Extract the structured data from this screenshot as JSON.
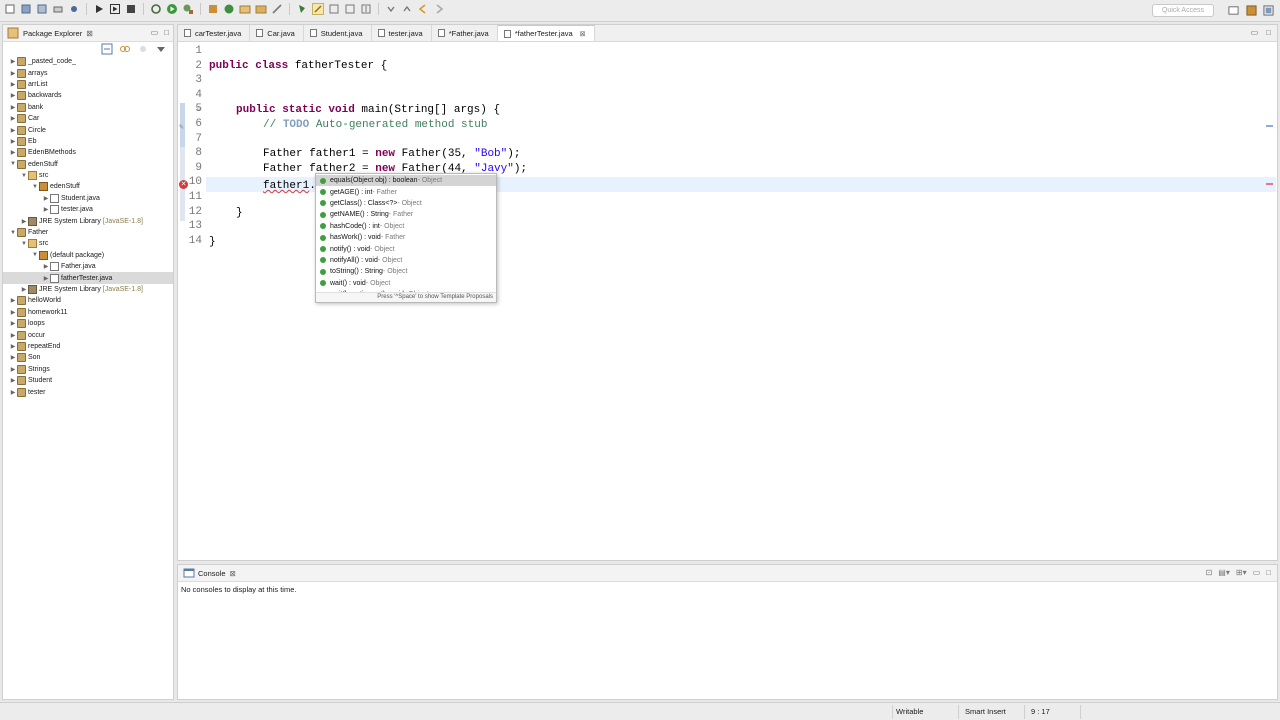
{
  "toolbar": {
    "quick_access_placeholder": "Quick Access"
  },
  "package_explorer": {
    "title": "Package Explorer",
    "items": [
      {
        "label": "_pasted_code_",
        "depth": 0,
        "toggle": "▶",
        "icon": "project-icon"
      },
      {
        "label": "arrays",
        "depth": 0,
        "toggle": "▶",
        "icon": "project-icon"
      },
      {
        "label": "arrList",
        "depth": 0,
        "toggle": "▶",
        "icon": "project-icon"
      },
      {
        "label": "backwards",
        "depth": 0,
        "toggle": "▶",
        "icon": "project-icon"
      },
      {
        "label": "bank",
        "depth": 0,
        "toggle": "▶",
        "icon": "project-icon"
      },
      {
        "label": "Car",
        "depth": 0,
        "toggle": "▶",
        "icon": "project-icon"
      },
      {
        "label": "Circle",
        "depth": 0,
        "toggle": "▶",
        "icon": "project-icon"
      },
      {
        "label": "Eb",
        "depth": 0,
        "toggle": "▶",
        "icon": "project-icon"
      },
      {
        "label": "EdenBMethods",
        "depth": 0,
        "toggle": "▶",
        "icon": "project-icon"
      },
      {
        "label": "edenStuff",
        "depth": 0,
        "toggle": "▼",
        "icon": "project-icon"
      },
      {
        "label": "src",
        "depth": 1,
        "toggle": "▼",
        "icon": "src-folder-icon"
      },
      {
        "label": "edenStuff",
        "depth": 2,
        "toggle": "▼",
        "icon": "package-icon"
      },
      {
        "label": "Student.java",
        "depth": 3,
        "toggle": "▶",
        "icon": "java-file-icon"
      },
      {
        "label": "tester.java",
        "depth": 3,
        "toggle": "▶",
        "icon": "java-file-icon"
      },
      {
        "label": "JRE System Library",
        "suffix": "[JavaSE-1.8]",
        "depth": 1,
        "toggle": "▶",
        "icon": "library-icon"
      },
      {
        "label": "Father",
        "depth": 0,
        "toggle": "▼",
        "icon": "project-icon"
      },
      {
        "label": "src",
        "depth": 1,
        "toggle": "▼",
        "icon": "src-folder-icon"
      },
      {
        "label": "(default package)",
        "depth": 2,
        "toggle": "▼",
        "icon": "package-icon"
      },
      {
        "label": "Father.java",
        "depth": 3,
        "toggle": "▶",
        "icon": "java-file-icon"
      },
      {
        "label": "fatherTester.java",
        "depth": 3,
        "toggle": "▶",
        "icon": "java-file-icon",
        "selected": true
      },
      {
        "label": "JRE System Library",
        "suffix": "[JavaSE-1.8]",
        "depth": 1,
        "toggle": "▶",
        "icon": "library-icon"
      },
      {
        "label": "helloWorld",
        "depth": 0,
        "toggle": "▶",
        "icon": "project-icon"
      },
      {
        "label": "homework11",
        "depth": 0,
        "toggle": "▶",
        "icon": "project-icon"
      },
      {
        "label": "loops",
        "depth": 0,
        "toggle": "▶",
        "icon": "project-icon"
      },
      {
        "label": "occur",
        "depth": 0,
        "toggle": "▶",
        "icon": "project-icon"
      },
      {
        "label": "repeatEnd",
        "depth": 0,
        "toggle": "▶",
        "icon": "project-icon"
      },
      {
        "label": "Son",
        "depth": 0,
        "toggle": "▶",
        "icon": "project-icon"
      },
      {
        "label": "Strings",
        "depth": 0,
        "toggle": "▶",
        "icon": "project-icon"
      },
      {
        "label": "Student",
        "depth": 0,
        "toggle": "▶",
        "icon": "project-icon"
      },
      {
        "label": "tester",
        "depth": 0,
        "toggle": "▶",
        "icon": "project-icon"
      }
    ]
  },
  "editor": {
    "tabs": [
      {
        "label": "carTester.java",
        "active": false
      },
      {
        "label": "Car.java",
        "active": false
      },
      {
        "label": "Student.java",
        "active": false
      },
      {
        "label": "tester.java",
        "active": false
      },
      {
        "label": "*Father.java",
        "active": false
      },
      {
        "label": "*fatherTester.java",
        "active": true
      }
    ],
    "line_numbers": [
      "1",
      "2",
      "3",
      "4",
      "5",
      "6",
      "7",
      "8",
      "9",
      "10",
      "11",
      "12",
      "13",
      "14"
    ],
    "code": {
      "l2_kw": "public class ",
      "l2_rest": "fatherTester {",
      "l4_kw": "public static void ",
      "l4_rest": "main(String[] args) {",
      "l5_comment_prefix": "// ",
      "l5_todo": "TODO",
      "l5_comment_rest": " Auto-generated method stub",
      "l7_a": "Father father1 = ",
      "l7_kw": "new",
      "l7_b": " Father(35, ",
      "l7_str": "\"Bob\"",
      "l7_c": ");",
      "l8_a": "Father father2 = ",
      "l8_kw": "new",
      "l8_b": " Father(44, ",
      "l8_str": "\"Javy\"",
      "l8_c": ");",
      "l9_err": "father1",
      "l9_dot": ".",
      "l11": "}",
      "l13": "}"
    }
  },
  "content_assist": {
    "items": [
      {
        "sig": "equals(Object obj) : boolean",
        "cls": " - Object"
      },
      {
        "sig": "getAGE() : int",
        "cls": " - Father"
      },
      {
        "sig": "getClass() : Class<?>",
        "cls": " - Object"
      },
      {
        "sig": "getNAME() : String",
        "cls": " - Father"
      },
      {
        "sig": "hashCode() : int",
        "cls": " - Object"
      },
      {
        "sig": "hasWork() : void",
        "cls": " - Father"
      },
      {
        "sig": "notify() : void",
        "cls": " - Object"
      },
      {
        "sig": "notifyAll() : void",
        "cls": " - Object"
      },
      {
        "sig": "toString() : String",
        "cls": " - Object"
      },
      {
        "sig": "wait() : void",
        "cls": " - Object"
      },
      {
        "sig": "wait(long timeout) : void",
        "cls": " - Object"
      }
    ],
    "footer": "Press '^Space' to show Template Proposals"
  },
  "console": {
    "title": "Console",
    "message": "No consoles to display at this time."
  },
  "status_bar": {
    "writable": "Writable",
    "insert_mode": "Smart Insert",
    "position": "9 : 17"
  }
}
